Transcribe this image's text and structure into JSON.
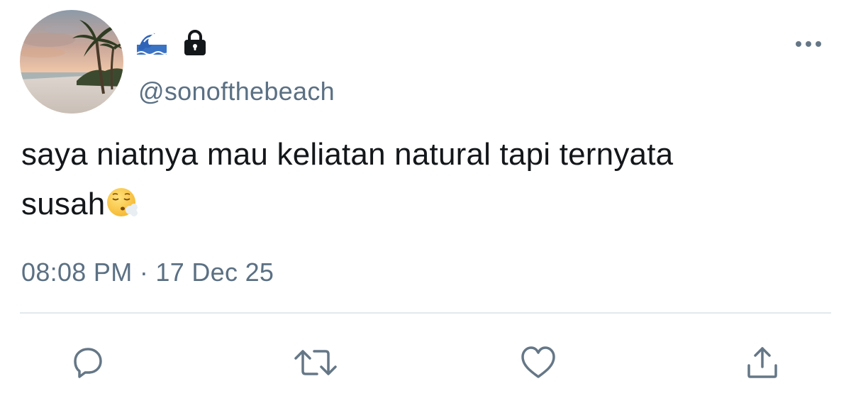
{
  "tweet": {
    "handle": "@sonofthebeach",
    "text_line1": "saya niatnya mau keliatan natural tapi ternyata",
    "text_line2": "susah",
    "time": "08:08 PM",
    "separator": "·",
    "date": "17 Dec 25"
  },
  "icons": {
    "display_name_emojis": [
      "water-wave-icon",
      "lock-icon"
    ],
    "text_emoji": "face-exhaling-icon",
    "more": "more-options-icon",
    "actions": [
      "reply-icon",
      "retweet-icon",
      "like-icon",
      "share-icon"
    ]
  },
  "colors": {
    "secondary_text": "#5b7083",
    "icon_gray": "#657786",
    "divider": "#e1e8ed",
    "primary_text": "#14171a"
  }
}
